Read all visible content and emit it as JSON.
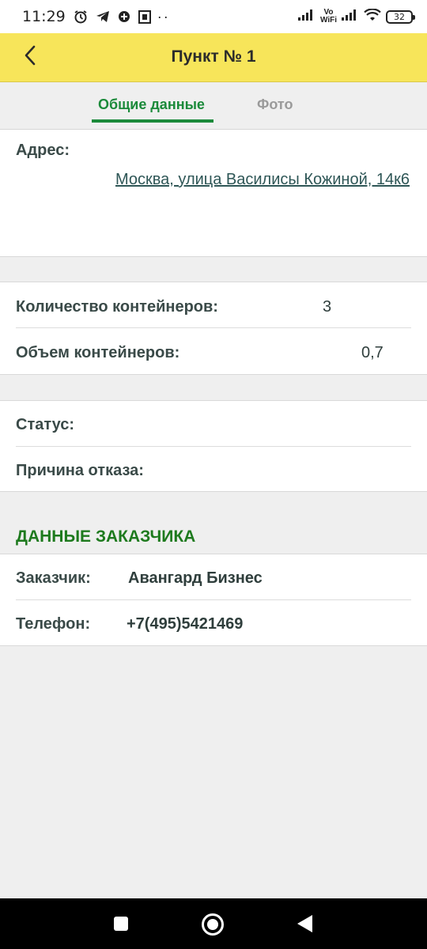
{
  "status_bar": {
    "time": "11:29",
    "network_label_top": "Vo",
    "network_label_bottom": "WiFi",
    "battery": "32",
    "icons": [
      "alarm-icon",
      "telegram-icon",
      "vpn-icon",
      "sim-icon",
      "signal-icon",
      "wifi-icon",
      "battery-icon"
    ]
  },
  "header": {
    "title": "Пункт № 1",
    "back_icon": "chevron-left-icon"
  },
  "tabs": [
    {
      "label": "Общие данные",
      "active": true
    },
    {
      "label": "Фото",
      "active": false
    }
  ],
  "address": {
    "label": "Адрес:",
    "value": "Москва, улица Василисы Кожиной, 14к6"
  },
  "containers": {
    "count_label": "Количество контейнеров:",
    "count_value": "3",
    "volume_label": "Объем контейнеров:",
    "volume_value": "0,7"
  },
  "status": {
    "status_label": "Статус:",
    "status_value": "",
    "reason_label": "Причина отказа:",
    "reason_value": ""
  },
  "customer": {
    "heading": "ДАННЫЕ ЗАКАЗЧИКА",
    "customer_label": "Заказчик:",
    "customer_value": "Авангард Бизнес",
    "phone_label": "Телефон:",
    "phone_value": "+7(495)5421469"
  },
  "colors": {
    "header_bg": "#f7e55a",
    "accent_green": "#1b8a3a",
    "heading_green": "#1e7a1e"
  }
}
